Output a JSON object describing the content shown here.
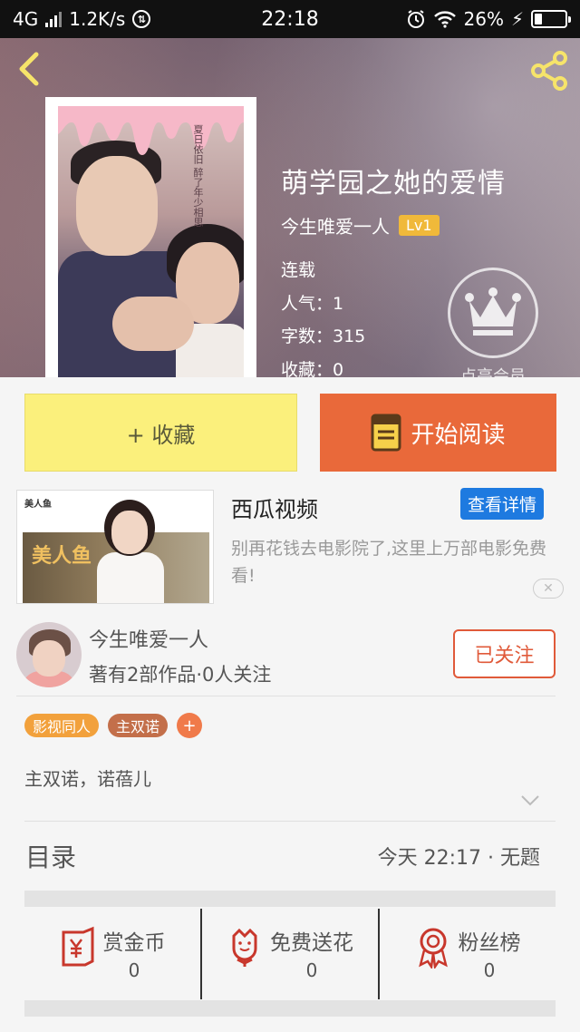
{
  "status_bar": {
    "network": "4G",
    "speed": "1.2K/s",
    "time": "22:18",
    "battery_percent": "26%",
    "battery_level": 0.26
  },
  "book": {
    "title": "萌学园之她的爱情",
    "author": "今生唯爱一人",
    "level": "Lv1",
    "status": "连载",
    "popularity": "人气：1",
    "word_count": "字数：315",
    "favorites": "收藏：0",
    "cover_text": "夏日依旧 醉了年少相思",
    "vip_label": "点亮会员"
  },
  "actions": {
    "favorite_label": "+ 收藏",
    "read_label": "开始阅读"
  },
  "ad": {
    "thumb_brand": "美人鱼",
    "thumb_text": "美人鱼",
    "title": "西瓜视频",
    "detail_button": "查看详情",
    "description": "别再花钱去电影院了,这里上万部电影免费看!",
    "close_glyph": "✕"
  },
  "author_card": {
    "name": "今生唯爱一人",
    "stats": "著有2部作品·0人关注",
    "follow_label": "已关注"
  },
  "tags": {
    "items": [
      {
        "label": "影视同人",
        "color": "#f2a13c"
      },
      {
        "label": "主双诺",
        "color": "#c36f4a"
      }
    ],
    "add_glyph": "+"
  },
  "intro": {
    "text": "主双诺，诺蓓儿"
  },
  "catalog": {
    "title": "目录",
    "latest": "今天 22:17 · 无题"
  },
  "stats": [
    {
      "label": "赏金币",
      "value": "0",
      "icon": "coin-envelope-icon"
    },
    {
      "label": "免费送花",
      "value": "0",
      "icon": "flower-icon"
    },
    {
      "label": "粉丝榜",
      "value": "0",
      "icon": "medal-icon"
    }
  ],
  "colors": {
    "accent_orange": "#e9693a",
    "favorite_yellow": "#fbf07c",
    "link_blue": "#1e7ae0",
    "icon_red": "#c8372c"
  }
}
